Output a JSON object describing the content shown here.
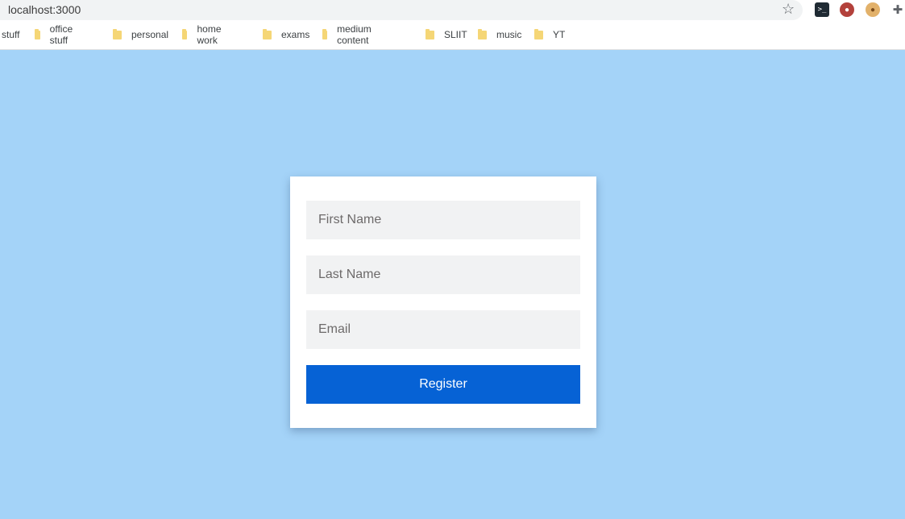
{
  "browser": {
    "url": "localhost:3000",
    "icons": [
      "star-icon",
      "terminal-extension-icon",
      "shield-extension-icon",
      "cookie-extension-icon",
      "puzzle-icon"
    ],
    "bookmarks": [
      "stuff",
      "office stuff",
      "personal",
      "home work",
      "exams",
      "medium content",
      "SLIIT",
      "music",
      "YT"
    ]
  },
  "form": {
    "first_name_placeholder": "First Name",
    "last_name_placeholder": "Last Name",
    "email_placeholder": "Email",
    "register_label": "Register"
  },
  "colors": {
    "page_background": "#a4d3f8",
    "button": "#0662d5",
    "field_background": "#f1f2f3"
  }
}
